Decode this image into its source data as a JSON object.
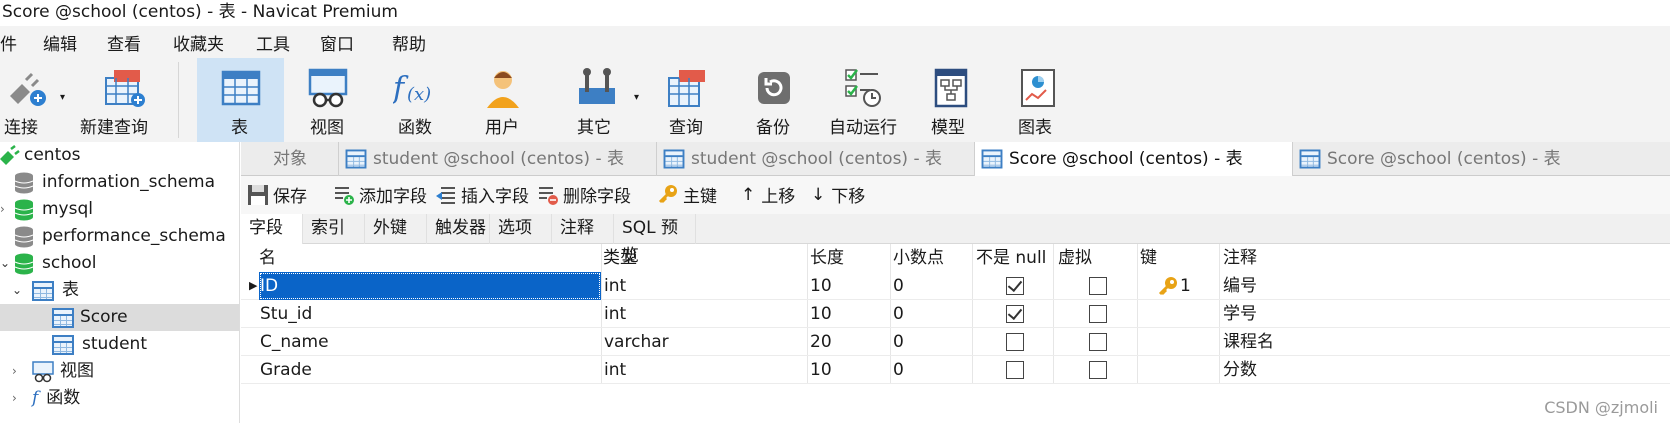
{
  "window": {
    "title": "Score @school (centos) - 表 - Navicat Premium"
  },
  "menu": [
    "件",
    "编辑",
    "查看",
    "收藏夹",
    "工具",
    "窗口",
    "帮助"
  ],
  "toolbar": [
    "连接",
    "新建查询",
    "表",
    "视图",
    "函数",
    "用户",
    "其它",
    "查询",
    "备份",
    "自动运行",
    "模型",
    "图表"
  ],
  "tree": {
    "connection": "centos",
    "dbs": [
      "information_schema",
      "mysql",
      "performance_schema",
      "school"
    ],
    "school_children": {
      "tables_label": "表",
      "tables": [
        "Score",
        "student"
      ],
      "views_label": "视图",
      "funcs_label": "函数"
    }
  },
  "tabs": [
    "对象",
    "student @school (centos) - 表",
    "student @school (centos) - 表",
    "Score @school (centos) - 表",
    "Score @school (centos) - 表"
  ],
  "edit_toolbar": [
    "保存",
    "添加字段",
    "插入字段",
    "删除字段",
    "主键",
    "上移",
    "下移"
  ],
  "subtabs": [
    "字段",
    "索引",
    "外键",
    "触发器",
    "选项",
    "注释",
    "SQL 预览"
  ],
  "columns": [
    "名",
    "类型",
    "长度",
    "小数点",
    "不是 null",
    "虚拟",
    "键",
    "注释"
  ],
  "rows": [
    {
      "name": "ID",
      "type": "int",
      "length": "10",
      "decimal": "0",
      "notnull": true,
      "virtual": false,
      "key": "1",
      "comment": "编号"
    },
    {
      "name": "Stu_id",
      "type": "int",
      "length": "10",
      "decimal": "0",
      "notnull": true,
      "virtual": false,
      "key": "",
      "comment": "学号"
    },
    {
      "name": "C_name",
      "type": "varchar",
      "length": "20",
      "decimal": "0",
      "notnull": false,
      "virtual": false,
      "key": "",
      "comment": "课程名"
    },
    {
      "name": "Grade",
      "type": "int",
      "length": "10",
      "decimal": "0",
      "notnull": false,
      "virtual": false,
      "key": "",
      "comment": "分数"
    }
  ],
  "watermark": "CSDN @zjmoli",
  "colors": {
    "selection": "#0a64c8",
    "active_toolbar": "#cfe3f5",
    "db_green": "#2bb34a",
    "table_blue": "#3d7fc4"
  }
}
